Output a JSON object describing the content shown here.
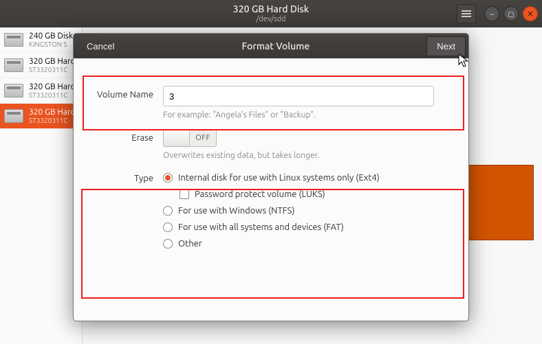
{
  "window": {
    "title": "320 GB Hard Disk",
    "subtitle": "/dev/sdd"
  },
  "sidebar": {
    "items": [
      {
        "title": "240 GB Disk",
        "subtitle": "KINGSTON S"
      },
      {
        "title": "320 GB Hard",
        "subtitle": "ST3320311C"
      },
      {
        "title": "320 GB Hard",
        "subtitle": "ST3320311C"
      },
      {
        "title": "320 GB Hard",
        "subtitle": "ST3320311C"
      }
    ]
  },
  "dialog": {
    "title": "Format Volume",
    "cancel": "Cancel",
    "next": "Next",
    "volume_name_label": "Volume Name",
    "volume_name_value": "3",
    "volume_name_hint": "For example: \"Angela's Files\" or \"Backup\".",
    "erase_label": "Erase",
    "erase_state": "OFF",
    "erase_hint": "Overwrites existing data, but takes longer.",
    "type_label": "Type",
    "type_options": {
      "ext4": "Internal disk for use with Linux systems only (Ext4)",
      "luks": "Password protect volume (LUKS)",
      "ntfs": "For use with Windows (NTFS)",
      "fat": "For use with all systems and devices (FAT)",
      "other": "Other"
    }
  }
}
